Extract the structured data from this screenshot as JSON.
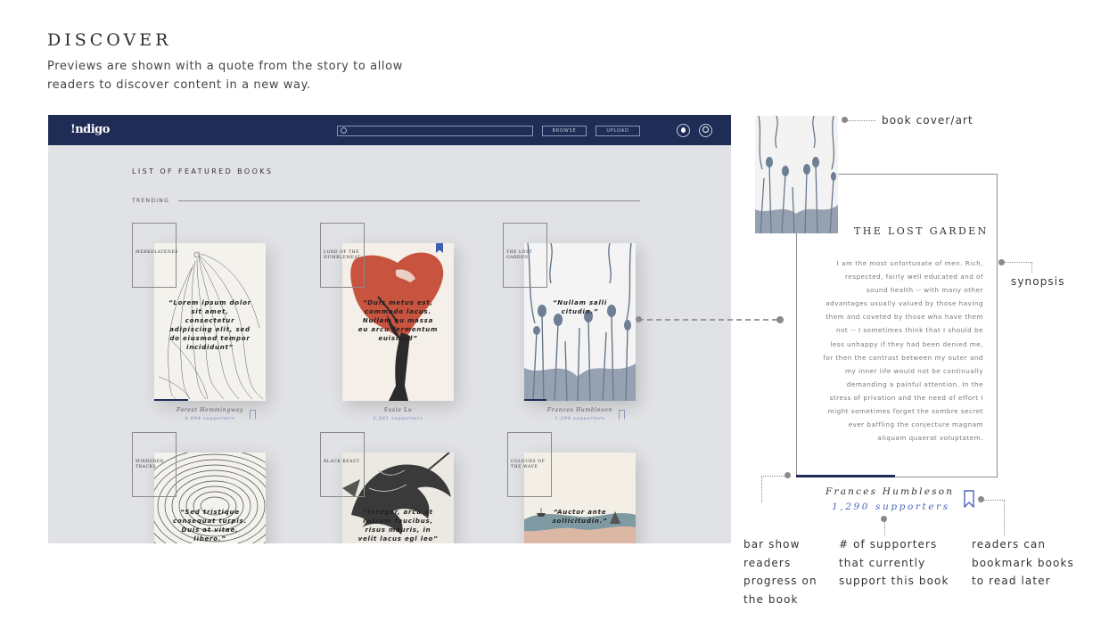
{
  "presentation": {
    "title": "DISCOVER",
    "subtitle": "Previews are shown with a quote from the story to allow readers to discover content in a new way."
  },
  "app": {
    "logo": "!ndigo",
    "search_placeholder": "",
    "nav": {
      "browse": "BROWSE",
      "upload": "UPLOAD"
    },
    "section_title": "LIST OF FEATURED BOOKS",
    "trending_label": "TRENDING",
    "colors": {
      "header": "#1f2c55",
      "background": "#e1e2e5",
      "accent": "#4a66b8"
    },
    "books": [
      {
        "title": "MERKOLATENES",
        "quote": "“Lorem ipsum dolor sit amet, consectetur adipiscing elit, sed do eiusmod tempor incididunt”",
        "author": "Forest Hemmingway",
        "supporters": "4,894 supporters",
        "progress": 0.3,
        "bookmarked": false,
        "art": "feather-line-art"
      },
      {
        "title": "LORD OF THE HUMBLEMEAT",
        "quote": "“Duis metus est, commodo lacus. Nullam eu massa eu arcu fermentum euismod”",
        "author": "Susie Lu",
        "supporters": "2,561 supporters",
        "progress": 0.0,
        "bookmarked": true,
        "art": "red-bird-tree"
      },
      {
        "title": "THE LOST GARDEN",
        "quote": "“Nullam salli citudin.”",
        "author": "Frances Humbleson",
        "supporters": "1,290 supporters",
        "progress": 0.2,
        "bookmarked": false,
        "art": "blue-garden"
      },
      {
        "title": "MIRRORED TRACKS",
        "quote": "“Sed tristique consequat turpis. Duis at vitae, libero.”",
        "art": "contour-rings"
      },
      {
        "title": "BLACK BEAST",
        "quote": "“Integer, arcu at rutrum faucibus, risus mauris, in velit lacus egl leo”",
        "art": "ink-beast"
      },
      {
        "title": "COLOURS OF THE WAVE",
        "quote": "“Auctor ante sollicitudin.”",
        "art": "pastel-landscape"
      }
    ]
  },
  "detail": {
    "title": "THE LOST GARDEN",
    "synopsis": "I am the most unfortunate of men. Rich, respected, fairly well educated and of sound health -- with many other advantages usually valued by those having them and coveted by those who have them not -- I sometimes think that I should be less unhappy if they had been denied me, for then the contrast between my outer and my inner life would not be continually demanding a painful attention. In the stress of privation and the need of effort I might sometimes forget the sombre secret ever baffling the conjecture magnam aliquam quaerat voluptatem.",
    "author": "Frances Humbleson",
    "supporters": "1,290 supporters",
    "progress": 0.5,
    "bookmarked": false
  },
  "callouts": {
    "cover": "book cover/art",
    "synopsis": "synopsis",
    "progress": "bar show readers progress on the book",
    "supporters": "# of supporters that currently support this book",
    "bookmark": "readers can bookmark books to read later"
  }
}
